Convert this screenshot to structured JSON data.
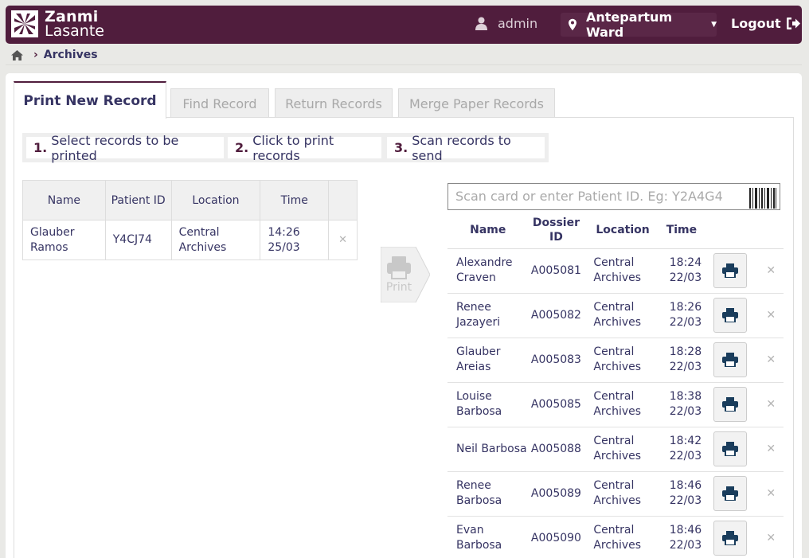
{
  "header": {
    "logo_line1": "Zanmi",
    "logo_line2": "Lasante",
    "user": "admin",
    "location": "Antepartum Ward",
    "logout": "Logout",
    "brand_color": "#501d3d"
  },
  "breadcrumb": {
    "home_icon": "home-icon",
    "current": "Archives"
  },
  "tabs": [
    {
      "label": "Print New Record",
      "active": true
    },
    {
      "label": "Find Record",
      "active": false
    },
    {
      "label": "Return Records",
      "active": false
    },
    {
      "label": "Merge Paper Records",
      "active": false
    }
  ],
  "steps": [
    {
      "num": "1.",
      "text": "Select records to be printed"
    },
    {
      "num": "2.",
      "text": "Click to print records"
    },
    {
      "num": "3.",
      "text": "Scan records to send"
    }
  ],
  "left_table": {
    "headers": [
      "Name",
      "Patient ID",
      "Location",
      "Time"
    ],
    "rows": [
      {
        "name": "Glauber Ramos",
        "id": "Y4CJ74",
        "location": "Central Archives",
        "time": "14:26 25/03"
      }
    ]
  },
  "print_button": {
    "label": "Print"
  },
  "scan": {
    "placeholder": "Scan card or enter Patient ID. Eg: Y2A4G4"
  },
  "right_table": {
    "headers": [
      "Name",
      "Dossier ID",
      "Location",
      "Time"
    ],
    "rows": [
      {
        "name": "Alexandre Craven",
        "id": "A005081",
        "location": "Central Archives",
        "time": "18:24 22/03"
      },
      {
        "name": "Renee Jazayeri",
        "id": "A005082",
        "location": "Central Archives",
        "time": "18:26 22/03"
      },
      {
        "name": "Glauber Areias",
        "id": "A005083",
        "location": "Central Archives",
        "time": "18:28 22/03"
      },
      {
        "name": "Louise Barbosa",
        "id": "A005085",
        "location": "Central Archives",
        "time": "18:38 22/03"
      },
      {
        "name": "Neil Barbosa",
        "id": "A005088",
        "location": "Central Archives",
        "time": "18:42 22/03"
      },
      {
        "name": "Renee Barbosa",
        "id": "A005089",
        "location": "Central Archives",
        "time": "18:46 22/03"
      },
      {
        "name": "Evan Barbosa",
        "id": "A005090",
        "location": "Central Archives",
        "time": "18:46 22/03"
      }
    ]
  }
}
